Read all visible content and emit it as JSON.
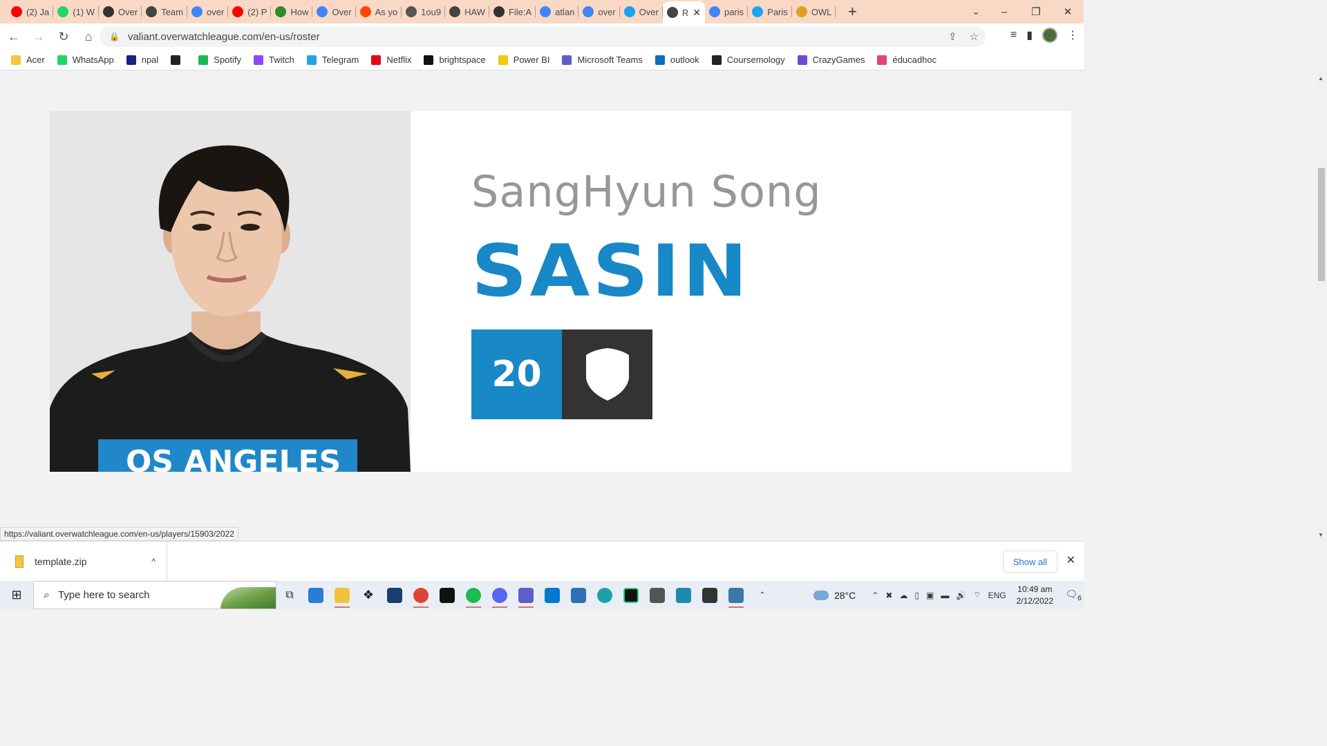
{
  "tabs": [
    {
      "title": "(2) Ja",
      "icon": "youtube-icon",
      "color": "#ff0000"
    },
    {
      "title": "(1) W",
      "icon": "whatsapp-icon",
      "color": "#25d366"
    },
    {
      "title": "Over",
      "icon": "overwatch-icon",
      "color": "#333333"
    },
    {
      "title": "Team",
      "icon": "team-icon",
      "color": "#444444"
    },
    {
      "title": "over",
      "icon": "google-icon",
      "color": "#4285f4"
    },
    {
      "title": "(2) P",
      "icon": "youtube-icon",
      "color": "#ff0000"
    },
    {
      "title": "How",
      "icon": "wikihow-icon",
      "color": "#2e8b2e"
    },
    {
      "title": "Over",
      "icon": "google-icon",
      "color": "#4285f4"
    },
    {
      "title": "As yo",
      "icon": "reddit-icon",
      "color": "#ff4500"
    },
    {
      "title": "1ou9",
      "icon": "globe-icon",
      "color": "#555555"
    },
    {
      "title": "HAW",
      "icon": "team-icon",
      "color": "#444444"
    },
    {
      "title": "File:A",
      "icon": "wikimedia-icon",
      "color": "#333333"
    },
    {
      "title": "atlan",
      "icon": "google-icon",
      "color": "#4285f4"
    },
    {
      "title": "over",
      "icon": "google-icon",
      "color": "#4285f4"
    },
    {
      "title": "Over",
      "icon": "twitter-icon",
      "color": "#1da1f2"
    },
    {
      "title": "R",
      "icon": "team-icon",
      "color": "#444444",
      "active": true
    },
    {
      "title": "paris",
      "icon": "google-icon",
      "color": "#4285f4"
    },
    {
      "title": "Paris",
      "icon": "twitter-icon",
      "color": "#1da1f2"
    },
    {
      "title": "OWL",
      "icon": "owl-icon",
      "color": "#e0a021"
    }
  ],
  "toolbar": {
    "url": "valiant.overwatchleague.com/en-us/roster"
  },
  "bookmarks": [
    {
      "label": "Acer",
      "icon": "folder-icon",
      "color": "#f5c542"
    },
    {
      "label": "WhatsApp",
      "icon": "whatsapp-icon",
      "color": "#25d366"
    },
    {
      "label": "npal",
      "icon": "npal-icon",
      "color": "#1a237e"
    },
    {
      "label": "",
      "icon": "globe-icon",
      "color": "#222222"
    },
    {
      "label": "Spotify",
      "icon": "spotify-icon",
      "color": "#1db954"
    },
    {
      "label": "Twitch",
      "icon": "twitch-icon",
      "color": "#9146ff"
    },
    {
      "label": "Telegram",
      "icon": "telegram-icon",
      "color": "#2aa3df"
    },
    {
      "label": "Netflix",
      "icon": "netflix-icon",
      "color": "#e50914"
    },
    {
      "label": "brightspace",
      "icon": "np-icon",
      "color": "#111111"
    },
    {
      "label": "Power BI",
      "icon": "powerbi-icon",
      "color": "#f2c811"
    },
    {
      "label": "Microsoft Teams",
      "icon": "teams-icon",
      "color": "#5b5fc7"
    },
    {
      "label": "outlook",
      "icon": "outlook-icon",
      "color": "#0f6cbd"
    },
    {
      "label": "Coursemology",
      "icon": "coursemology-icon",
      "color": "#222222"
    },
    {
      "label": "CrazyGames",
      "icon": "crazygames-icon",
      "color": "#6c4bd6"
    },
    {
      "label": "éducadhoc",
      "icon": "educadhoc-icon",
      "color": "#e0457b"
    }
  ],
  "player": {
    "real_name": "SangHyun Song",
    "handle": "SASIN",
    "number": "20",
    "role_icon": "tank-shield-icon"
  },
  "status_url": "https://valiant.overwatchleague.com/en-us/players/15903/2022",
  "download": {
    "filename": "template.zip",
    "show_all": "Show all"
  },
  "taskbar": {
    "search_placeholder": "Type here to search",
    "weather": "28°C",
    "lang": "ENG",
    "time": "10:49 am",
    "date": "2/12/2022",
    "notifications": "6"
  },
  "colors": {
    "accent_blue": "#1888c7",
    "role_dark": "#333333",
    "tabstrip": "#f9d9c6"
  }
}
